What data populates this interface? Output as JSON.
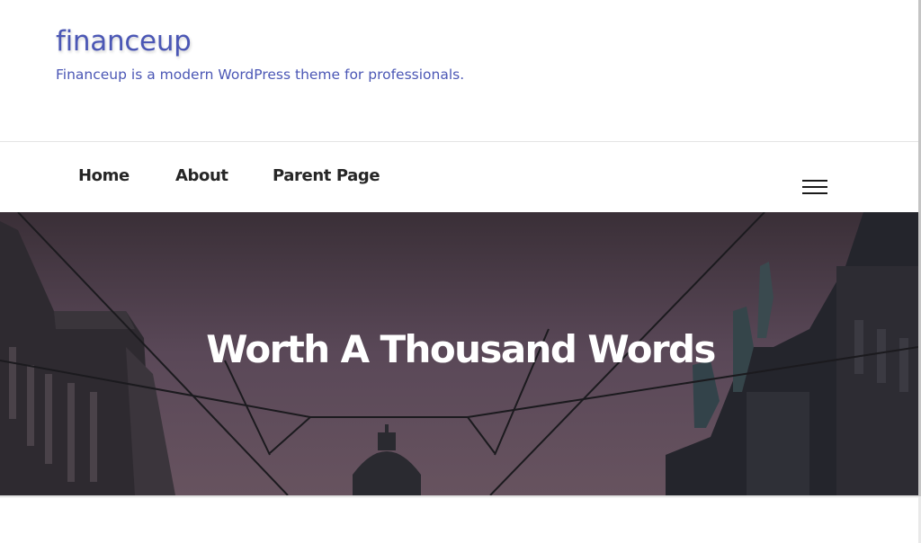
{
  "site": {
    "title": "financeup",
    "tagline": "Financeup is a modern WordPress theme for professionals."
  },
  "nav": {
    "items": [
      {
        "label": "Home"
      },
      {
        "label": "About"
      },
      {
        "label": "Parent Page"
      }
    ],
    "menu_icon": "hamburger-menu-icon"
  },
  "hero": {
    "title": "Worth A Thousand Words"
  },
  "colors": {
    "brand": "#4b57b5",
    "nav_text": "#262626",
    "hero_overlay": "#574656"
  }
}
